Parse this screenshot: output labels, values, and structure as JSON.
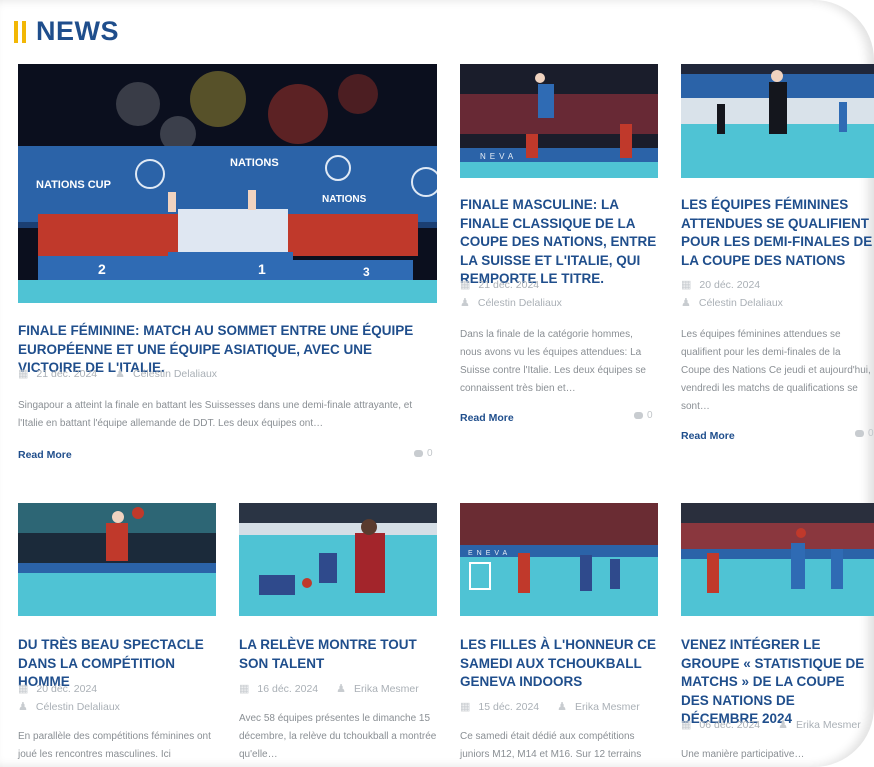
{
  "header": {
    "title": "NEWS"
  },
  "featured": {
    "title": "FINALE FÉMININE: MATCH AU SOMMET ENTRE UNE ÉQUIPE EUROPÉENNE ET UNE ÉQUIPE ASIATIQUE, AVEC UNE VICTOIRE DE L'ITALIE.",
    "date": "21 déc. 2024",
    "author": "Célestin Delaliaux",
    "excerpt": "Singapour a atteint la finale en battant les Suissesses dans une demi-finale attrayante, et l'Italie en battant l'équipe allemande de DDT. Les deux équipes ont…",
    "read_more": "Read More",
    "comments": "0",
    "image_text": {
      "nations_cup": "NATIONS CUP",
      "podium_2": "2",
      "podium_1": "1",
      "podium_3": "3"
    }
  },
  "side_cards": [
    {
      "title": "FINALE MASCULINE: LA FINALE CLASSIQUE DE LA COUPE DES NATIONS, ENTRE LA SUISSE ET L'ITALIE, QUI REMPORTE LE TITRE.",
      "date": "21 déc. 2024",
      "author": "Célestin Delaliaux",
      "excerpt": "Dans la finale de la catégorie hommes, nous avons vu les équipes attendues: La Suisse contre l'Italie. Les deux équipes se connaissent très bien et…",
      "read_more": "Read More",
      "comments": "0"
    },
    {
      "title": "LES ÉQUIPES FÉMININES ATTENDUES SE QUALIFIENT POUR LES DEMI-FINALES DE LA COUPE DES NATIONS",
      "date": "20 déc. 2024",
      "author": "Célestin Delaliaux",
      "excerpt": "Les équipes féminines attendues se qualifient pour les demi-finales de la Coupe des Nations Ce jeudi et aujourd'hui, vendredi les matchs de qualifications se sont…",
      "read_more": "Read More",
      "comments": "0"
    }
  ],
  "bottom_cards": [
    {
      "title": "DU TRÈS BEAU SPECTACLE DANS LA COMPÉTITION HOMME",
      "date": "20 déc. 2024",
      "author": "Célestin Delaliaux",
      "excerpt": "En parallèle des compétitions féminines ont joué les rencontres masculines. Ici"
    },
    {
      "title": "LA RELÈVE MONTRE TOUT SON TALENT",
      "date": "16 déc. 2024",
      "author": "Erika Mesmer",
      "excerpt": "Avec 58 équipes présentes le dimanche 15 décembre, la relève du tchoukball a montrée qu'elle…"
    },
    {
      "title": "LES FILLES À L'HONNEUR CE SAMEDI AUX TCHOUKBALL GENEVA INDOORS",
      "date": "15 déc. 2024",
      "author": "Erika Mesmer",
      "excerpt": "Ce samedi était dédié aux compétitions juniors M12, M14 et M16. Sur 12 terrains"
    },
    {
      "title": "VENEZ INTÉGRER LE GROUPE « STATISTIQUE DE MATCHS » DE LA COUPE DES NATIONS DE DÉCEMBRE 2024",
      "date": "06 déc. 2024",
      "author": "Erika Mesmer",
      "excerpt": "Une manière participative…"
    }
  ],
  "colors": {
    "accent": "#f2b705",
    "title_blue": "#1f4e8c",
    "court": "#3fb5c9"
  }
}
